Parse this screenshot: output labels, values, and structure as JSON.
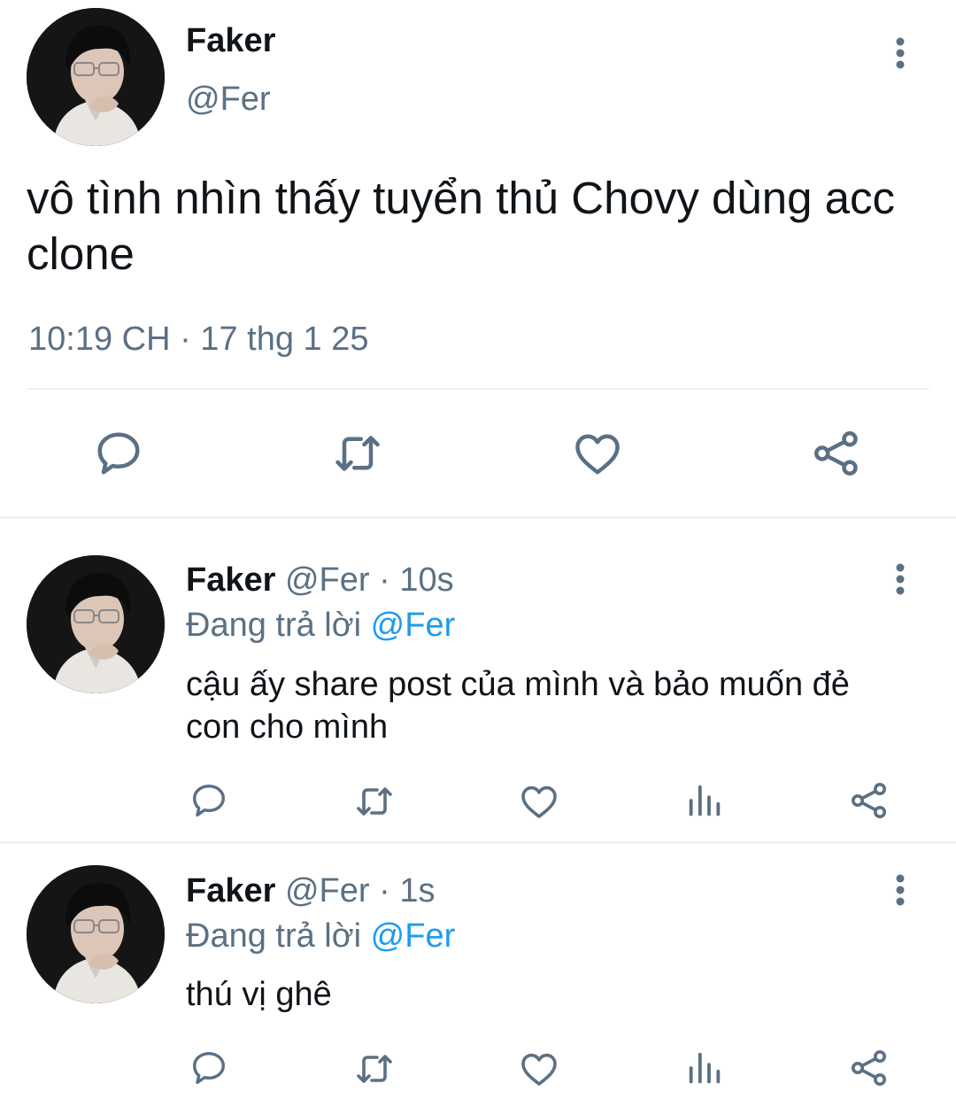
{
  "main_tweet": {
    "display_name": "Faker",
    "handle": "@Fer",
    "text_line1": "vô tình nhìn thấy tuyển thủ Chovy dùng acc",
    "text_line2": "clone",
    "timestamp": "10:19 CH · 17 thg 1 25",
    "actions": [
      "reply-icon",
      "retweet-icon",
      "like-icon",
      "share-icon"
    ]
  },
  "replies": [
    {
      "display_name": "Faker",
      "handle": "@Fer",
      "time": " · 10s",
      "replying_prefix": "Đang trả lời ",
      "replying_to": "@Fer",
      "text_line1": "cậu ấy share post của mình và bảo muốn đẻ",
      "text_line2": "con cho mình"
    },
    {
      "display_name": "Faker",
      "handle": "@Fer",
      "time": " · 1s",
      "replying_prefix": "Đang trả lời ",
      "replying_to": "@Fer",
      "text_line1": "thú vị ghê",
      "text_line2": ""
    }
  ],
  "reply_actions": [
    "reply-icon",
    "retweet-icon",
    "like-icon",
    "analytics-icon",
    "share-icon"
  ],
  "colors": {
    "icon_gray": "#5b7083",
    "link_blue": "#1d9bf0",
    "divider": "#eff3f4"
  }
}
